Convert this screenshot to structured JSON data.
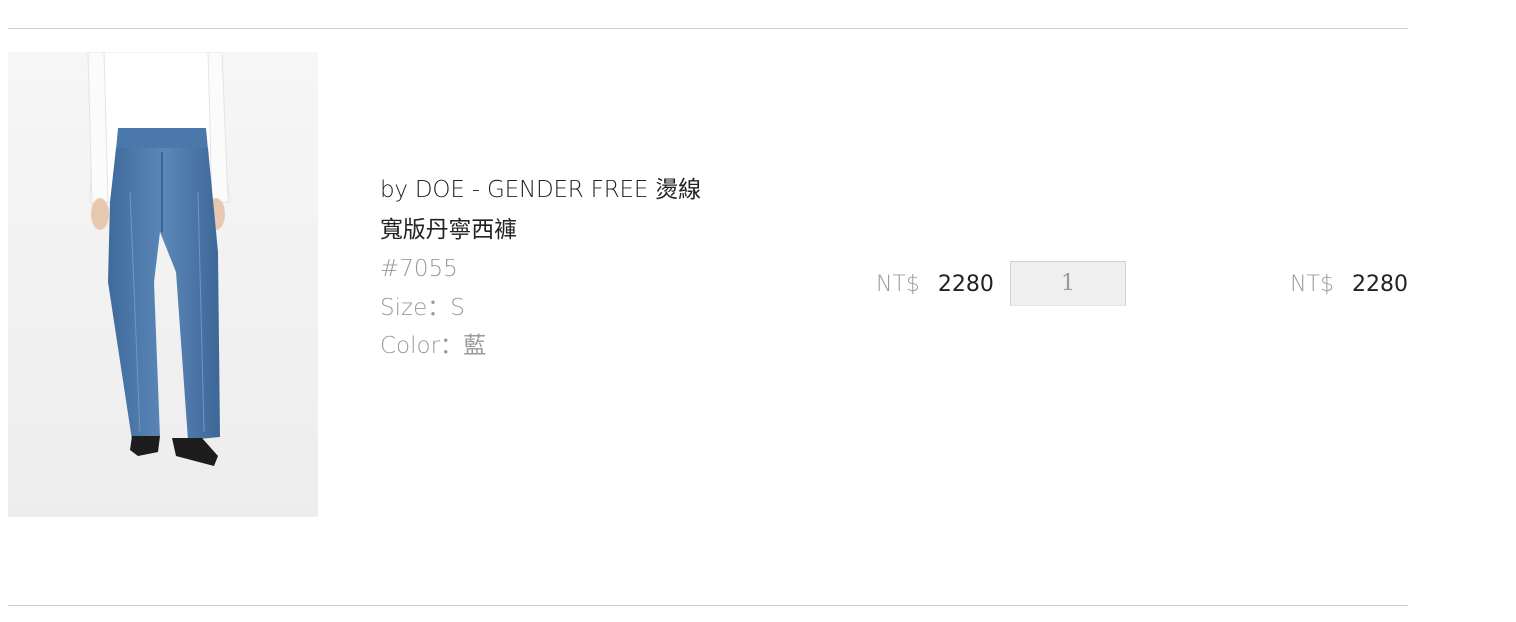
{
  "item": {
    "name_line1": "by DOE - GENDER FREE 燙線",
    "name_line2": "寬版丹寧西褲",
    "sku": "#7055",
    "size_label": "Size：",
    "size_value": "S",
    "color_label": "Color：",
    "color_value": "藍",
    "image_alt": "Wide-leg denim trousers product photo"
  },
  "unit_price": {
    "currency": "NT$",
    "amount": "2280"
  },
  "quantity": {
    "value": "1"
  },
  "total_price": {
    "currency": "NT$",
    "amount": "2280"
  },
  "colors": {
    "denim": "#4a76a8",
    "shirt": "#ffffff",
    "divider": "#cfcfcf",
    "muted_text": "#9a9a9a"
  }
}
